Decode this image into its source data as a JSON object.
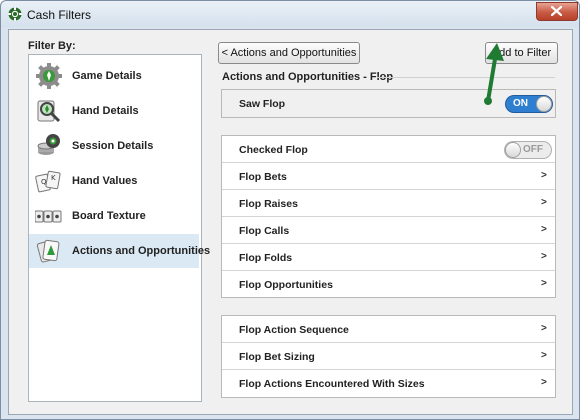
{
  "window": {
    "title": "Cash Filters"
  },
  "sidebar": {
    "heading": "Filter By:",
    "items": [
      {
        "label": "Game Details",
        "icon": "gear-icon"
      },
      {
        "label": "Hand Details",
        "icon": "hand-search-icon"
      },
      {
        "label": "Session Details",
        "icon": "poker-chips-icon"
      },
      {
        "label": "Hand Values",
        "icon": "playing-cards-icon"
      },
      {
        "label": "Board Texture",
        "icon": "board-cards-icon"
      },
      {
        "label": "Actions and Opportunities",
        "icon": "green-card-icon",
        "selected": true
      }
    ]
  },
  "toolbar": {
    "back_label": "< Actions and Opportunities",
    "add_label": "Add to Filter"
  },
  "section": {
    "title": "Actions and Opportunities - Flop"
  },
  "saw_flop": {
    "label": "Saw Flop",
    "toggle": "ON"
  },
  "group1": [
    {
      "label": "Checked Flop",
      "toggle": "OFF"
    },
    {
      "label": "Flop Bets",
      "chevron": ">"
    },
    {
      "label": "Flop Raises",
      "chevron": ">"
    },
    {
      "label": "Flop Calls",
      "chevron": ">"
    },
    {
      "label": "Flop Folds",
      "chevron": ">"
    },
    {
      "label": "Flop Opportunities",
      "chevron": ">"
    }
  ],
  "group2": [
    {
      "label": "Flop Action Sequence",
      "chevron": ">"
    },
    {
      "label": "Flop Bet Sizing",
      "chevron": ">"
    },
    {
      "label": "Flop Actions Encountered With Sizes",
      "chevron": ">"
    }
  ],
  "colors": {
    "accent": "#2f7fd0",
    "selected": "#dbe9f4",
    "arrow": "#1f7a32"
  }
}
